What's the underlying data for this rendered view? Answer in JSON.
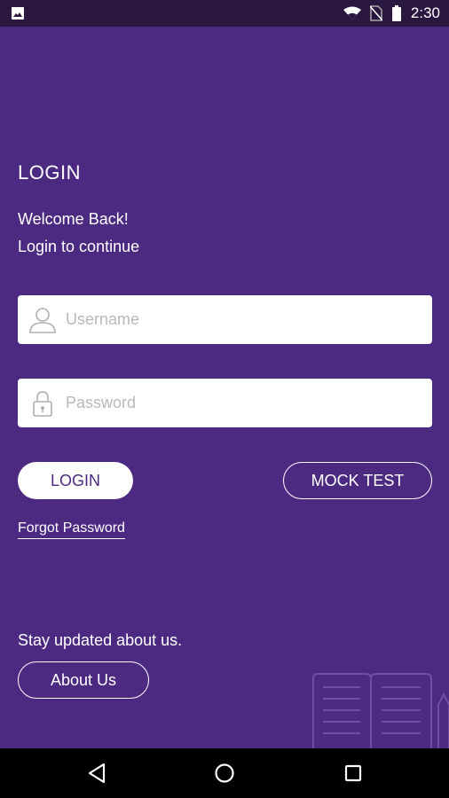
{
  "status_bar": {
    "time": "2:30",
    "icons": [
      "image-icon",
      "wifi-icon",
      "no-sim-icon",
      "battery-icon"
    ]
  },
  "login": {
    "title": "LOGIN",
    "welcome": "Welcome Back!",
    "subtitle": "Login to continue",
    "username_placeholder": "Username",
    "username_value": "",
    "password_placeholder": "Password",
    "password_value": "",
    "login_label": "LOGIN",
    "mock_test_label": "MOCK TEST",
    "forgot_label": "Forgot Password"
  },
  "footer": {
    "stay_updated": "Stay updated about us.",
    "about_label": "About Us"
  },
  "nav": {
    "icons": [
      "back-icon",
      "home-icon",
      "recents-icon"
    ]
  },
  "colors": {
    "background": "#4c2a82",
    "status_bar": "#2a1740",
    "nav_bar": "#000000",
    "field": "#ffffff",
    "placeholder": "#b9b9b9"
  }
}
